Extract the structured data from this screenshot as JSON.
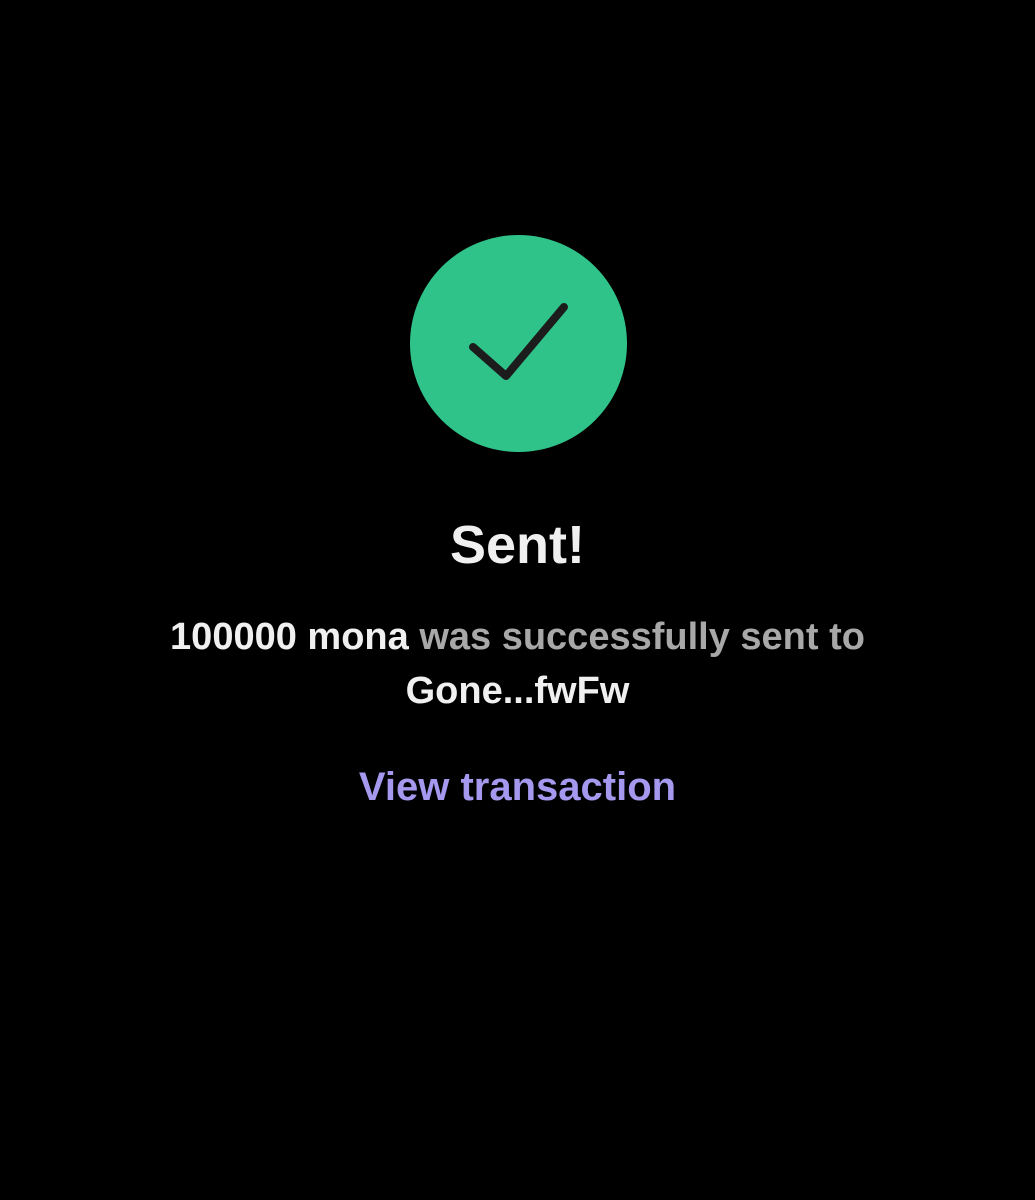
{
  "icon": {
    "name": "checkmark-icon",
    "background_color": "#2fc38a",
    "mark_color": "#1c1c1c"
  },
  "title": "Sent!",
  "message": {
    "amount": "100000 mona",
    "middle": " was successfully sent to ",
    "recipient": "Gone...fwFw"
  },
  "link": {
    "label": "View transaction",
    "color": "#a498ef"
  }
}
